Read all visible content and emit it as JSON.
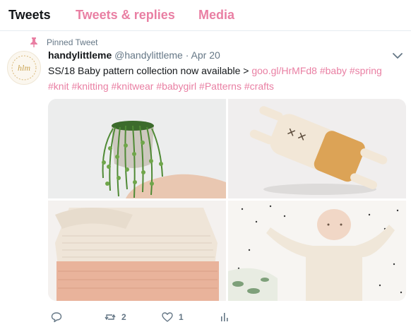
{
  "tabs": [
    {
      "label": "Tweets"
    },
    {
      "label": "Tweets & replies"
    },
    {
      "label": "Media"
    }
  ],
  "pinned": {
    "label": "Pinned Tweet"
  },
  "tweet": {
    "name": "handylittleme",
    "handle": "@handylittleme",
    "separator": "·",
    "date": "Apr 20",
    "text_line1": "SS/18 Baby pattern collection now available >",
    "link": "goo.gl/HrMFd8",
    "hashtags_line1": [
      "#baby",
      "#spring"
    ],
    "hashtags_line2": [
      "#knit",
      "#knitting",
      "#knitwear",
      "#babygirl",
      "#Patterns",
      "#crafts"
    ],
    "avatar_text": "hlm",
    "images": [
      {
        "description_icon": "plant-pot-image"
      },
      {
        "description_icon": "knitted-toy-image"
      },
      {
        "description_icon": "knitted-sweater-image"
      },
      {
        "description_icon": "baby-photo-image"
      }
    ],
    "actions": {
      "reply_count": "",
      "retweet_count": "2",
      "like_count": "1"
    }
  },
  "colors": {
    "accent": "#e97fa3",
    "muted": "#657786",
    "text": "#14171a",
    "divider": "#e6ecf0"
  }
}
